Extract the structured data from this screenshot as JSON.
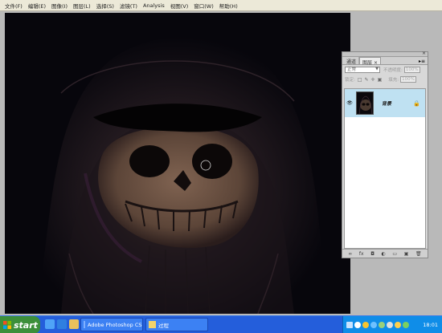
{
  "menubar": {
    "items": [
      "文件(F)",
      "编辑(E)",
      "图像(I)",
      "图层(L)",
      "选择(S)",
      "滤镜(T)",
      "Analysis",
      "视图(V)",
      "窗口(W)",
      "帮助(H)"
    ]
  },
  "layers_panel": {
    "tabs": [
      "通道",
      "图层"
    ],
    "tab_close": "×",
    "blend_mode": "正常",
    "opacity_label": "不透明度:",
    "opacity_value": "100%",
    "lock_label": "锁定:",
    "fill_label": "填充:",
    "fill_value": "100%",
    "layer": {
      "name": "背景",
      "visibility_icon": "eye-icon",
      "lock_icon": "lock-icon"
    },
    "footer_icons": [
      "link-icon",
      "fx-icon",
      "mask-icon",
      "adjustment-icon",
      "folder-icon",
      "new-layer-icon",
      "trash-icon"
    ]
  },
  "taskbar": {
    "start_label": "start",
    "buttons": [
      {
        "label": "Adobe Photoshop CS...",
        "icon": "photoshop-icon"
      },
      {
        "label": "过程",
        "icon": "folder-icon"
      }
    ],
    "clock": "18:01"
  },
  "colors": {
    "canvas_bg": "#07060c",
    "layer_selected": "#bfe1f2",
    "taskbar": "#245edb",
    "start": "#3c8f3a"
  }
}
